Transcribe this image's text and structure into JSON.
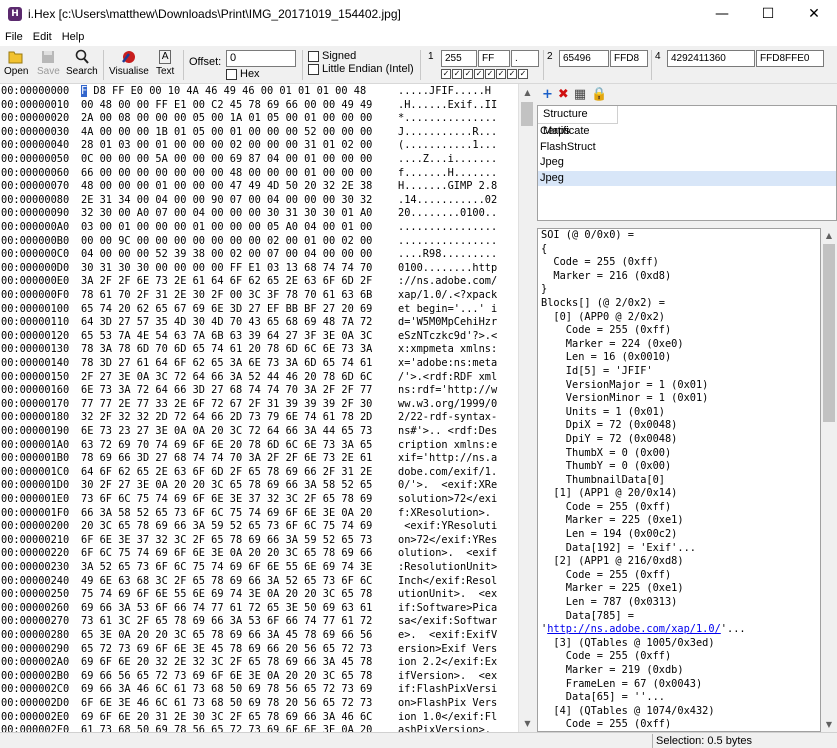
{
  "window": {
    "title": "i.Hex [c:\\Users\\matthew\\Downloads\\Print\\IMG_20171019_154402.jpg]",
    "app_icon": "H",
    "minimize": "—",
    "maximize": "☐",
    "close": "✕"
  },
  "menu": {
    "file": "File",
    "edit": "Edit",
    "help": "Help"
  },
  "toolbar": {
    "open": "Open",
    "save": "Save",
    "search": "Search",
    "visualise": "Visualise",
    "text": "Text",
    "offset_label": "Offset:",
    "offset_value": "0",
    "hex_label": "Hex",
    "signed_label": "Signed",
    "little_endian_label": "Little Endian (Intel)",
    "g1_num": "1",
    "g1_dec": "255",
    "g1_hex": "FF",
    "g1_chr": ".",
    "g2_num": "2",
    "g2_dec": "65496",
    "g2_hex": "FFD8",
    "g4_num": "4",
    "g4_dec": "4292411360",
    "g4_hex": "FFD8FFE0",
    "bits": [
      "✓",
      "✓",
      "✓",
      "✓",
      "✓",
      "✓",
      "✓",
      "✓"
    ]
  },
  "hex_rows": [
    {
      "addr": "00:00000000",
      "hex": " D8 FF E0 00 10 4A 46 49 46 00 01 01 01 00 48",
      "first": "F",
      "ascii": ".....JFIF.....H"
    },
    {
      "addr": "00:00000010",
      "hex": "00 48 00 00 FF E1 00 C2 45 78 69 66 00 00 49 49",
      "ascii": ".H......Exif..II"
    },
    {
      "addr": "00:00000020",
      "hex": "2A 00 08 00 00 00 05 00 1A 01 05 00 01 00 00 00",
      "ascii": "*..............."
    },
    {
      "addr": "00:00000030",
      "hex": "4A 00 00 00 1B 01 05 00 01 00 00 00 52 00 00 00",
      "ascii": "J...........R..."
    },
    {
      "addr": "00:00000040",
      "hex": "28 01 03 00 01 00 00 00 02 00 00 00 31 01 02 00",
      "ascii": "(...........1..."
    },
    {
      "addr": "00:00000050",
      "hex": "0C 00 00 00 5A 00 00 00 69 87 04 00 01 00 00 00",
      "ascii": "....Z...i......."
    },
    {
      "addr": "00:00000060",
      "hex": "66 00 00 00 00 00 00 00 48 00 00 00 01 00 00 00",
      "ascii": "f.......H......."
    },
    {
      "addr": "00:00000070",
      "hex": "48 00 00 00 01 00 00 00 47 49 4D 50 20 32 2E 38",
      "ascii": "H.......GIMP 2.8"
    },
    {
      "addr": "00:00000080",
      "hex": "2E 31 34 00 04 00 00 90 07 00 04 00 00 00 30 32",
      "ascii": ".14...........02"
    },
    {
      "addr": "00:00000090",
      "hex": "32 30 00 A0 07 00 04 00 00 00 30 31 30 30 01 A0",
      "ascii": "20........0100.."
    },
    {
      "addr": "00:000000A0",
      "hex": "03 00 01 00 00 00 01 00 00 00 05 A0 04 00 01 00",
      "ascii": "................"
    },
    {
      "addr": "00:000000B0",
      "hex": "00 00 9C 00 00 00 00 00 00 00 02 00 01 00 02 00",
      "ascii": "................"
    },
    {
      "addr": "00:000000C0",
      "hex": "04 00 00 00 52 39 38 00 02 00 07 00 04 00 00 00",
      "ascii": "....R98........."
    },
    {
      "addr": "00:000000D0",
      "hex": "30 31 30 30 00 00 00 00 FF E1 03 13 68 74 74 70",
      "ascii": "0100........http"
    },
    {
      "addr": "00:000000E0",
      "hex": "3A 2F 2F 6E 73 2E 61 64 6F 62 65 2E 63 6F 6D 2F",
      "ascii": "://ns.adobe.com/"
    },
    {
      "addr": "00:000000F0",
      "hex": "78 61 70 2F 31 2E 30 2F 00 3C 3F 78 70 61 63 6B",
      "ascii": "xap/1.0/.<?xpack"
    },
    {
      "addr": "00:00000100",
      "hex": "65 74 20 62 65 67 69 6E 3D 27 EF BB BF 27 20 69",
      "ascii": "et begin='...' i"
    },
    {
      "addr": "00:00000110",
      "hex": "64 3D 27 57 35 4D 30 4D 70 43 65 68 69 48 7A 72",
      "ascii": "d='W5M0MpCehiHzr"
    },
    {
      "addr": "00:00000120",
      "hex": "65 53 7A 4E 54 63 7A 6B 63 39 64 27 3F 3E 0A 3C",
      "ascii": "eSzNTczkc9d'?>.<"
    },
    {
      "addr": "00:00000130",
      "hex": "78 3A 78 6D 70 6D 65 74 61 20 78 6D 6C 6E 73 3A",
      "ascii": "x:xmpmeta xmlns:"
    },
    {
      "addr": "00:00000140",
      "hex": "78 3D 27 61 64 6F 62 65 3A 6E 73 3A 6D 65 74 61",
      "ascii": "x='adobe:ns:meta"
    },
    {
      "addr": "00:00000150",
      "hex": "2F 27 3E 0A 3C 72 64 66 3A 52 44 46 20 78 6D 6C",
      "ascii": "/'>.<rdf:RDF xml"
    },
    {
      "addr": "00:00000160",
      "hex": "6E 73 3A 72 64 66 3D 27 68 74 74 70 3A 2F 2F 77",
      "ascii": "ns:rdf='http://w"
    },
    {
      "addr": "00:00000170",
      "hex": "77 77 2E 77 33 2E 6F 72 67 2F 31 39 39 39 2F 30",
      "ascii": "ww.w3.org/1999/0"
    },
    {
      "addr": "00:00000180",
      "hex": "32 2F 32 32 2D 72 64 66 2D 73 79 6E 74 61 78 2D",
      "ascii": "2/22-rdf-syntax-"
    },
    {
      "addr": "00:00000190",
      "hex": "6E 73 23 27 3E 0A 0A 20 3C 72 64 66 3A 44 65 73",
      "ascii": "ns#'>.. <rdf:Des"
    },
    {
      "addr": "00:000001A0",
      "hex": "63 72 69 70 74 69 6F 6E 20 78 6D 6C 6E 73 3A 65",
      "ascii": "cription xmlns:e"
    },
    {
      "addr": "00:000001B0",
      "hex": "78 69 66 3D 27 68 74 74 70 3A 2F 2F 6E 73 2E 61",
      "ascii": "xif='http://ns.a"
    },
    {
      "addr": "00:000001C0",
      "hex": "64 6F 62 65 2E 63 6F 6D 2F 65 78 69 66 2F 31 2E",
      "ascii": "dobe.com/exif/1."
    },
    {
      "addr": "00:000001D0",
      "hex": "30 2F 27 3E 0A 20 20 3C 65 78 69 66 3A 58 52 65",
      "ascii": "0/'>.  <exif:XRe"
    },
    {
      "addr": "00:000001E0",
      "hex": "73 6F 6C 75 74 69 6F 6E 3E 37 32 3C 2F 65 78 69",
      "ascii": "solution>72</exi"
    },
    {
      "addr": "00:000001F0",
      "hex": "66 3A 58 52 65 73 6F 6C 75 74 69 6F 6E 3E 0A 20",
      "ascii": "f:XResolution>. "
    },
    {
      "addr": "00:00000200",
      "hex": "20 3C 65 78 69 66 3A 59 52 65 73 6F 6C 75 74 69",
      "ascii": " <exif:YResoluti"
    },
    {
      "addr": "00:00000210",
      "hex": "6F 6E 3E 37 32 3C 2F 65 78 69 66 3A 59 52 65 73",
      "ascii": "on>72</exif:YRes"
    },
    {
      "addr": "00:00000220",
      "hex": "6F 6C 75 74 69 6F 6E 3E 0A 20 20 3C 65 78 69 66",
      "ascii": "olution>.  <exif"
    },
    {
      "addr": "00:00000230",
      "hex": "3A 52 65 73 6F 6C 75 74 69 6F 6E 55 6E 69 74 3E",
      "ascii": ":ResolutionUnit>"
    },
    {
      "addr": "00:00000240",
      "hex": "49 6E 63 68 3C 2F 65 78 69 66 3A 52 65 73 6F 6C",
      "ascii": "Inch</exif:Resol"
    },
    {
      "addr": "00:00000250",
      "hex": "75 74 69 6F 6E 55 6E 69 74 3E 0A 20 20 3C 65 78",
      "ascii": "utionUnit>.  <ex"
    },
    {
      "addr": "00:00000260",
      "hex": "69 66 3A 53 6F 66 74 77 61 72 65 3E 50 69 63 61",
      "ascii": "if:Software>Pica"
    },
    {
      "addr": "00:00000270",
      "hex": "73 61 3C 2F 65 78 69 66 3A 53 6F 66 74 77 61 72",
      "ascii": "sa</exif:Softwar"
    },
    {
      "addr": "00:00000280",
      "hex": "65 3E 0A 20 20 3C 65 78 69 66 3A 45 78 69 66 56",
      "ascii": "e>.  <exif:ExifV"
    },
    {
      "addr": "00:00000290",
      "hex": "65 72 73 69 6F 6E 3E 45 78 69 66 20 56 65 72 73",
      "ascii": "ersion>Exif Vers"
    },
    {
      "addr": "00:000002A0",
      "hex": "69 6F 6E 20 32 2E 32 3C 2F 65 78 69 66 3A 45 78",
      "ascii": "ion 2.2</exif:Ex"
    },
    {
      "addr": "00:000002B0",
      "hex": "69 66 56 65 72 73 69 6F 6E 3E 0A 20 20 3C 65 78",
      "ascii": "ifVersion>.  <ex"
    },
    {
      "addr": "00:000002C0",
      "hex": "69 66 3A 46 6C 61 73 68 50 69 78 56 65 72 73 69",
      "ascii": "if:FlashPixVersi"
    },
    {
      "addr": "00:000002D0",
      "hex": "6F 6E 3E 46 6C 61 73 68 50 69 78 20 56 65 72 73",
      "ascii": "on>FlashPix Vers"
    },
    {
      "addr": "00:000002E0",
      "hex": "69 6F 6E 20 31 2E 30 3C 2F 65 78 69 66 3A 46 6C",
      "ascii": "ion 1.0</exif:Fl"
    },
    {
      "addr": "00:000002F0",
      "hex": "61 73 68 50 69 78 56 65 72 73 69 6F 6E 3E 0A 20",
      "ascii": "ashPixVersion>. "
    }
  ],
  "structure_maps": {
    "header": "Structure Maps",
    "items": [
      "Certificate",
      "FlashStruct",
      "Jpeg",
      "Jpeg"
    ],
    "selected_index": 3
  },
  "tree_lines": [
    "SOI (@ 0/0x0) =",
    "{",
    "  Code = 255 (0xff)",
    "  Marker = 216 (0xd8)",
    "}",
    "Blocks[] (@ 2/0x2) =",
    "  [0] (APP0 @ 2/0x2)",
    "    Code = 255 (0xff)",
    "    Marker = 224 (0xe0)",
    "    Len = 16 (0x0010)",
    "    Id[5] = 'JFIF'",
    "    VersionMajor = 1 (0x01)",
    "    VersionMinor = 1 (0x01)",
    "    Units = 1 (0x01)",
    "    DpiX = 72 (0x0048)",
    "    DpiY = 72 (0x0048)",
    "    ThumbX = 0 (0x00)",
    "    ThumbY = 0 (0x00)",
    "    ThumbnailData[0]",
    "  [1] (APP1 @ 20/0x14)",
    "    Code = 255 (0xff)",
    "    Marker = 225 (0xe1)",
    "    Len = 194 (0x00c2)",
    "    Data[192] = 'Exif'...",
    "  [2] (APP1 @ 216/0xd8)",
    "    Code = 255 (0xff)",
    "    Marker = 225 (0xe1)",
    "    Len = 787 (0x0313)",
    "    Data[785] =",
    "",
    "  [3] (QTables @ 1005/0x3ed)",
    "    Code = 255 (0xff)",
    "    Marker = 219 (0xdb)",
    "    FrameLen = 67 (0x0043)",
    "    Data[65] = ''...",
    "  [4] (QTables @ 1074/0x432)",
    "    Code = 255 (0xff)"
  ],
  "tree_link": {
    "pre": "'",
    "url": "http://ns.adobe.com/xap/1.0/",
    "post": "'..."
  },
  "status": {
    "selection": "Selection: 0.5 bytes"
  },
  "colors": {
    "cursor": "#3366cc",
    "selected_item": "#d8e6f8",
    "link": "#0000ee"
  }
}
